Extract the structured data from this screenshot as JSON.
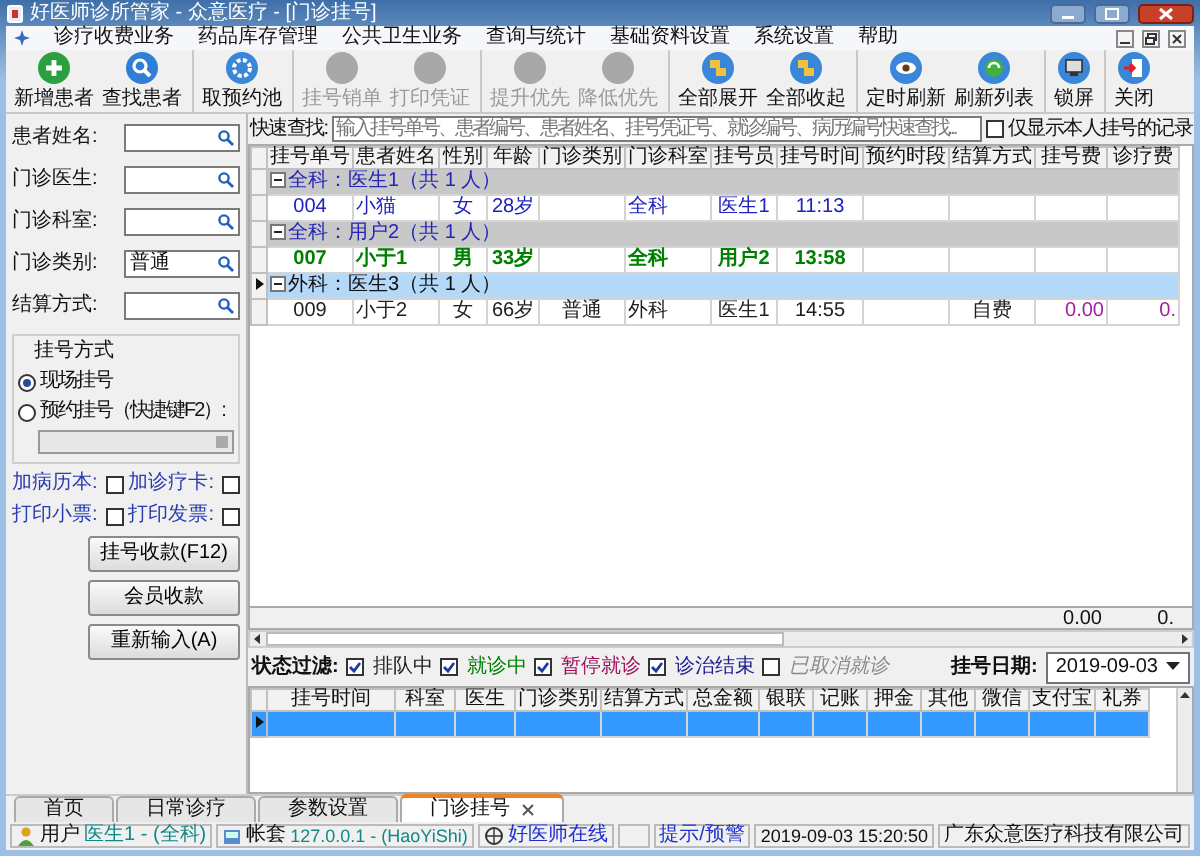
{
  "window": {
    "title": "好医师诊所管家 - 众意医疗 - [门诊挂号]"
  },
  "menu": [
    "诊疗收费业务",
    "药品库存管理",
    "公共卫生业务",
    "查询与统计",
    "基础资料设置",
    "系统设置",
    "帮助"
  ],
  "toolbar": [
    {
      "label": "新增患者",
      "kind": "add",
      "disabled": false,
      "separator_before": false
    },
    {
      "label": "查找患者",
      "kind": "search",
      "disabled": false,
      "separator_before": false
    },
    {
      "label": "取预约池",
      "kind": "pool",
      "disabled": false,
      "separator_before": true
    },
    {
      "label": "挂号销单",
      "kind": "blank",
      "disabled": true,
      "separator_before": true
    },
    {
      "label": "打印凭证",
      "kind": "blank",
      "disabled": true,
      "separator_before": false
    },
    {
      "label": "提升优先",
      "kind": "blank",
      "disabled": true,
      "separator_before": true
    },
    {
      "label": "降低优先",
      "kind": "blank",
      "disabled": true,
      "separator_before": false
    },
    {
      "label": "全部展开",
      "kind": "folder",
      "disabled": false,
      "separator_before": true
    },
    {
      "label": "全部收起",
      "kind": "folder",
      "disabled": false,
      "separator_before": false
    },
    {
      "label": "定时刷新",
      "kind": "eye",
      "disabled": false,
      "separator_before": true
    },
    {
      "label": "刷新列表",
      "kind": "refresh",
      "disabled": false,
      "separator_before": false
    },
    {
      "label": "锁屏",
      "kind": "monitor",
      "disabled": false,
      "separator_before": true
    },
    {
      "label": "关闭",
      "kind": "exit",
      "disabled": false,
      "separator_before": true
    }
  ],
  "form": {
    "fields": [
      {
        "label": "患者姓名:"
      },
      {
        "label": "门诊医生:"
      },
      {
        "label": "门诊科室:"
      },
      {
        "label": "门诊类别:",
        "value": "普通"
      },
      {
        "label": "结算方式:"
      }
    ],
    "registration_mode": {
      "title": "挂号方式",
      "options": [
        {
          "label": "现场挂号",
          "selected": true
        },
        {
          "label": "预约挂号（快捷键F2）:",
          "selected": false
        }
      ]
    },
    "checkboxes": [
      {
        "label": "加病历本:",
        "checked": false
      },
      {
        "label": "加诊疗卡:",
        "checked": false
      },
      {
        "label": "打印小票:",
        "checked": false
      },
      {
        "label": "打印发票:",
        "checked": false
      }
    ],
    "buttons": [
      "挂号收款(F12)",
      "会员收款",
      "重新输入(A)"
    ]
  },
  "quick_search": {
    "label": "快速查找:",
    "placeholder": "输入挂号单号、患者编号、患者姓名、挂号凭证号、就诊编号、病历编号快速查找...",
    "own_only": {
      "label": "仅显示本人挂号的记录",
      "checked": false
    }
  },
  "table": {
    "columns": [
      {
        "label": "挂号单号"
      },
      {
        "label": "患者姓名"
      },
      {
        "label": "性别"
      },
      {
        "label": "年龄"
      },
      {
        "label": "门诊类别"
      },
      {
        "label": "门诊科室"
      },
      {
        "label": "挂号员"
      },
      {
        "label": "挂号时间"
      },
      {
        "label": "预约时段"
      },
      {
        "label": "结算方式"
      },
      {
        "label": "挂号费",
        "total": "0.00"
      },
      {
        "label": "诊疗费",
        "total": "0."
      }
    ],
    "groups": [
      {
        "label": "全科：医生1（共 1 人）",
        "expanded": true,
        "selected": false,
        "rows": [
          {
            "color": "#2020c0",
            "cells": [
              "004",
              "小猫",
              "女",
              "28岁",
              null,
              "全科",
              "医生1",
              "11:13",
              null,
              null,
              null,
              null
            ]
          }
        ]
      },
      {
        "label": "全科：用户2（共 1 人）",
        "expanded": true,
        "selected": false,
        "rows": [
          {
            "color": "#008000",
            "cells": [
              "007",
              "小于1",
              "男",
              "33岁",
              null,
              "全科",
              "用户2",
              "13:58",
              null,
              null,
              null,
              null
            ]
          }
        ]
      },
      {
        "label": "外科：医生3（共 1 人）",
        "expanded": true,
        "selected": true,
        "rows": [
          {
            "color": "#202020",
            "cells": [
              "009",
              "小于2",
              "女",
              "66岁",
              "普通",
              "外科",
              "医生1",
              "14:55",
              null,
              "自费",
              "0.00",
              "0."
            ]
          }
        ]
      }
    ]
  },
  "status_filter": {
    "label": "状态过滤:",
    "options": [
      {
        "label": "排队中",
        "checked": true,
        "color": "#202020"
      },
      {
        "label": "就诊中",
        "checked": true,
        "color": "#008000"
      },
      {
        "label": "暂停就诊",
        "checked": true,
        "color": "#a0105a"
      },
      {
        "label": "诊治结束",
        "checked": true,
        "color": "#202090"
      },
      {
        "label": "已取消就诊",
        "checked": false,
        "color": "#8a8a8a"
      }
    ],
    "date_label": "挂号日期:",
    "date": "2019-09-03"
  },
  "payments_table": {
    "columns": [
      "挂号时间",
      "科室",
      "医生",
      "门诊类别",
      "结算方式",
      "总金额",
      "银联",
      "记账",
      "押金",
      "其他",
      "微信",
      "支付宝",
      "礼券"
    ],
    "rows": [
      {
        "selected": true
      }
    ]
  },
  "tabs": [
    {
      "label": "首页",
      "selected": false
    },
    {
      "label": "日常诊疗",
      "selected": false
    },
    {
      "label": "参数设置",
      "selected": false
    },
    {
      "label": "门诊挂号",
      "selected": true
    }
  ],
  "status_bar": [
    {
      "kind": "user",
      "label": "用户",
      "value": "医生1 - (全科)"
    },
    {
      "kind": "account",
      "label": "帐套",
      "value": "127.0.0.1 - (HaoYiShi)"
    },
    {
      "kind": "online",
      "value": "好医师在线"
    },
    {
      "kind": "empty"
    },
    {
      "kind": "alert",
      "value": "提示/预警"
    },
    {
      "kind": "plain",
      "value": "2019-09-03 15:20:50"
    },
    {
      "kind": "plain",
      "value": "广东众意医疗科技有限公司"
    }
  ]
}
